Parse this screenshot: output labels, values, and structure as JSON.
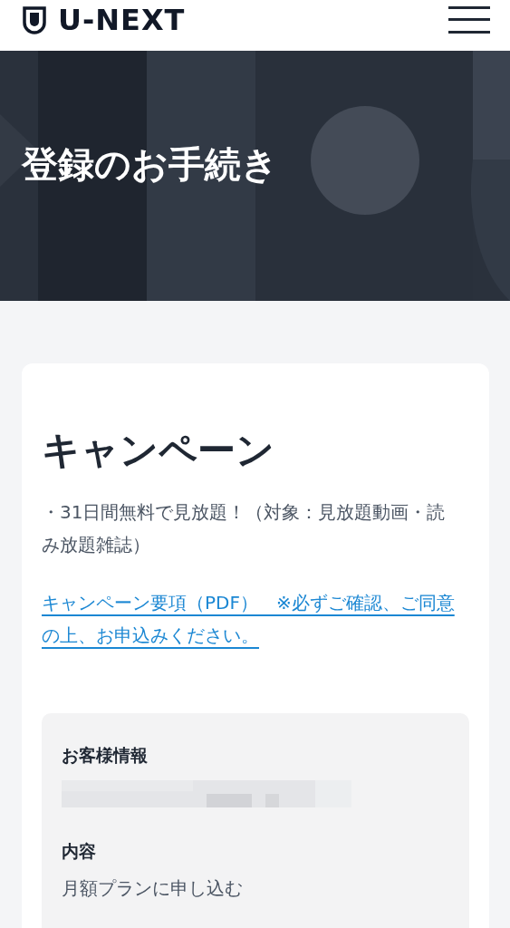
{
  "header": {
    "logo": "U-NEXT"
  },
  "hero": {
    "title": "登録のお手続き"
  },
  "campaign": {
    "title": "キャンペーン",
    "description": "・31日間無料で見放題！（対象：見放題動画・読み放題雑誌）",
    "link": "キャンペーン要項（PDF）　※必ずご確認、ご同意の上、お申込みください。"
  },
  "summary": [
    {
      "label": "お客様情報",
      "kind": "redacted"
    },
    {
      "label": "内容",
      "kind": "text",
      "value": "月額プランに申し込む"
    }
  ]
}
